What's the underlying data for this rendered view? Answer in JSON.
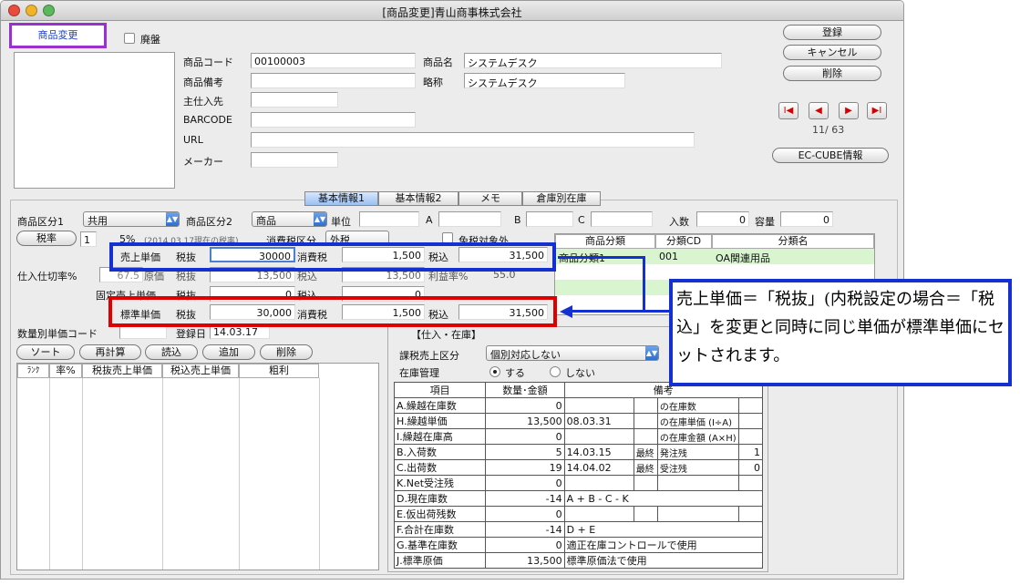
{
  "window": {
    "title": "[商品変更]青山商事株式会社"
  },
  "mode_label": "商品変更",
  "discontinued_label": "廃盤",
  "product": {
    "code_label": "商品コード",
    "code": "00100003",
    "name_label": "商品名",
    "name": "システムデスク",
    "note_label": "商品備考",
    "abbr_label": "略称",
    "abbr": "システムデスク",
    "supplier_label": "主仕入先",
    "barcode_label": "BARCODE",
    "url_label": "URL",
    "maker_label": "メーカー"
  },
  "actions": {
    "register": "登録",
    "cancel": "キャンセル",
    "delete": "削除",
    "ec_cube": "EC-CUBE情報"
  },
  "nav": {
    "first": "I◀",
    "prev": "◀",
    "next": "▶",
    "last": "▶I",
    "position": "11/  63"
  },
  "tabs": [
    "基本情報1",
    "基本情報2",
    "メモ",
    "倉庫別在庫"
  ],
  "row1": {
    "cat1_label": "商品区分1",
    "cat1": "共用",
    "cat2_label": "商品区分2",
    "cat2": "商品",
    "unit_label": "単位",
    "a_label": "A",
    "b_label": "B",
    "c_label": "C",
    "irisu_label": "入数",
    "irisu": "0",
    "capacity_label": "容量",
    "capacity": "0"
  },
  "tax": {
    "button": "税率",
    "value": "1",
    "rate": "5%",
    "rate_note": "(2014.03.17現在の税率)",
    "tax_type_label": "消費税区分",
    "tax_type": "外税",
    "exempt_label": "免税対象外"
  },
  "purchase_rate_label": "仕入仕切率%",
  "purchase_rate": "67.5",
  "cost_label": "原価",
  "sale_price": {
    "label": "売上単価",
    "excl_label": "税抜",
    "excl": "30000",
    "tax_label": "消費税",
    "tax": "1,500",
    "incl_label": "税込",
    "incl": "31,500"
  },
  "cost_row": {
    "excl": "13,500",
    "incl": "13,500",
    "profit_label": "利益率%",
    "profit": "55.0"
  },
  "fixed_price": {
    "label": "固定売上単価",
    "excl_label": "税抜",
    "excl": "0",
    "incl_label": "税込",
    "incl": "0"
  },
  "standard_price": {
    "label": "標準単価",
    "excl_label": "税抜",
    "excl": "30,000",
    "tax_label": "消費税",
    "tax": "1,500",
    "incl_label": "税込",
    "incl": "31,500"
  },
  "qty_price_code_label": "数量別単価コード",
  "registered_label": "登録日",
  "registered": "14.03.17",
  "category_table": {
    "headers": [
      "商品分類",
      "分類CD",
      "分類名"
    ],
    "rows": [
      [
        "商品分類1",
        "001",
        "OA関連用品"
      ]
    ]
  },
  "price_list": {
    "buttons": [
      "ソート",
      "再計算",
      "読込",
      "追加",
      "削除"
    ],
    "headers": [
      "ﾗﾝｸ",
      "率%",
      "税抜売上単価",
      "税込売上単価",
      "粗利"
    ]
  },
  "stock": {
    "title": "【仕入・在庫】",
    "sale_type_label": "課税売上区分",
    "sale_type": "個別対応しない",
    "manage_label": "在庫管理",
    "manage_on": "する",
    "manage_off": "しない",
    "headers": [
      "項目",
      "数量･金額",
      "備考"
    ],
    "rows": [
      {
        "item": "A.繰越在庫数",
        "value": "0",
        "d1": "",
        "d2": "",
        "d3": "の在庫数",
        "d4": ""
      },
      {
        "item": "H.繰越単価",
        "value": "13,500",
        "d1": "08.03.31",
        "d2": "",
        "d3": "の在庫単価 (I÷A)",
        "d4": ""
      },
      {
        "item": "I.繰越在庫高",
        "value": "0",
        "d1": "",
        "d2": "",
        "d3": "の在庫金額 (A×H)",
        "d4": ""
      },
      {
        "item": "B.入荷数",
        "value": "5",
        "d1": "14.03.15",
        "d2": "最終",
        "d3": "発注残",
        "d4": "1"
      },
      {
        "item": "C.出荷数",
        "value": "19",
        "d1": "14.04.02",
        "d2": "最終",
        "d3": "受注残",
        "d4": "0"
      },
      {
        "item": "K.Net受注残",
        "value": "0",
        "d1": "",
        "d2": "",
        "d3": "",
        "d4": ""
      },
      {
        "item": "D.現在庫数",
        "value": "-14",
        "d1": "A + B - C - K",
        "d2": "",
        "d3": "",
        "d4": ""
      },
      {
        "item": "E.仮出荷残数",
        "value": "0",
        "d1": "",
        "d2": "",
        "d3": "",
        "d4": ""
      },
      {
        "item": "F.合計在庫数",
        "value": "-14",
        "d1": "D + E",
        "d2": "",
        "d3": "",
        "d4": ""
      },
      {
        "item": "G.基準在庫数",
        "value": "0",
        "d1": "適正在庫コントロールで使用",
        "d2": "",
        "d3": "",
        "d4": ""
      },
      {
        "item": "J.標準原価",
        "value": "13,500",
        "d1": "標準原価法で使用",
        "d2": "",
        "d3": "",
        "d4": ""
      }
    ]
  },
  "callout": "売上単価＝「税抜」(内税設定の場合＝「税込」を変更と同時に同じ単価が標準単価にセットされます。",
  "colors": {
    "callout_border": "#1530d0",
    "highlight_red": "#e00000",
    "mode_border": "#9b30d0",
    "nav_red": "#d40000"
  }
}
